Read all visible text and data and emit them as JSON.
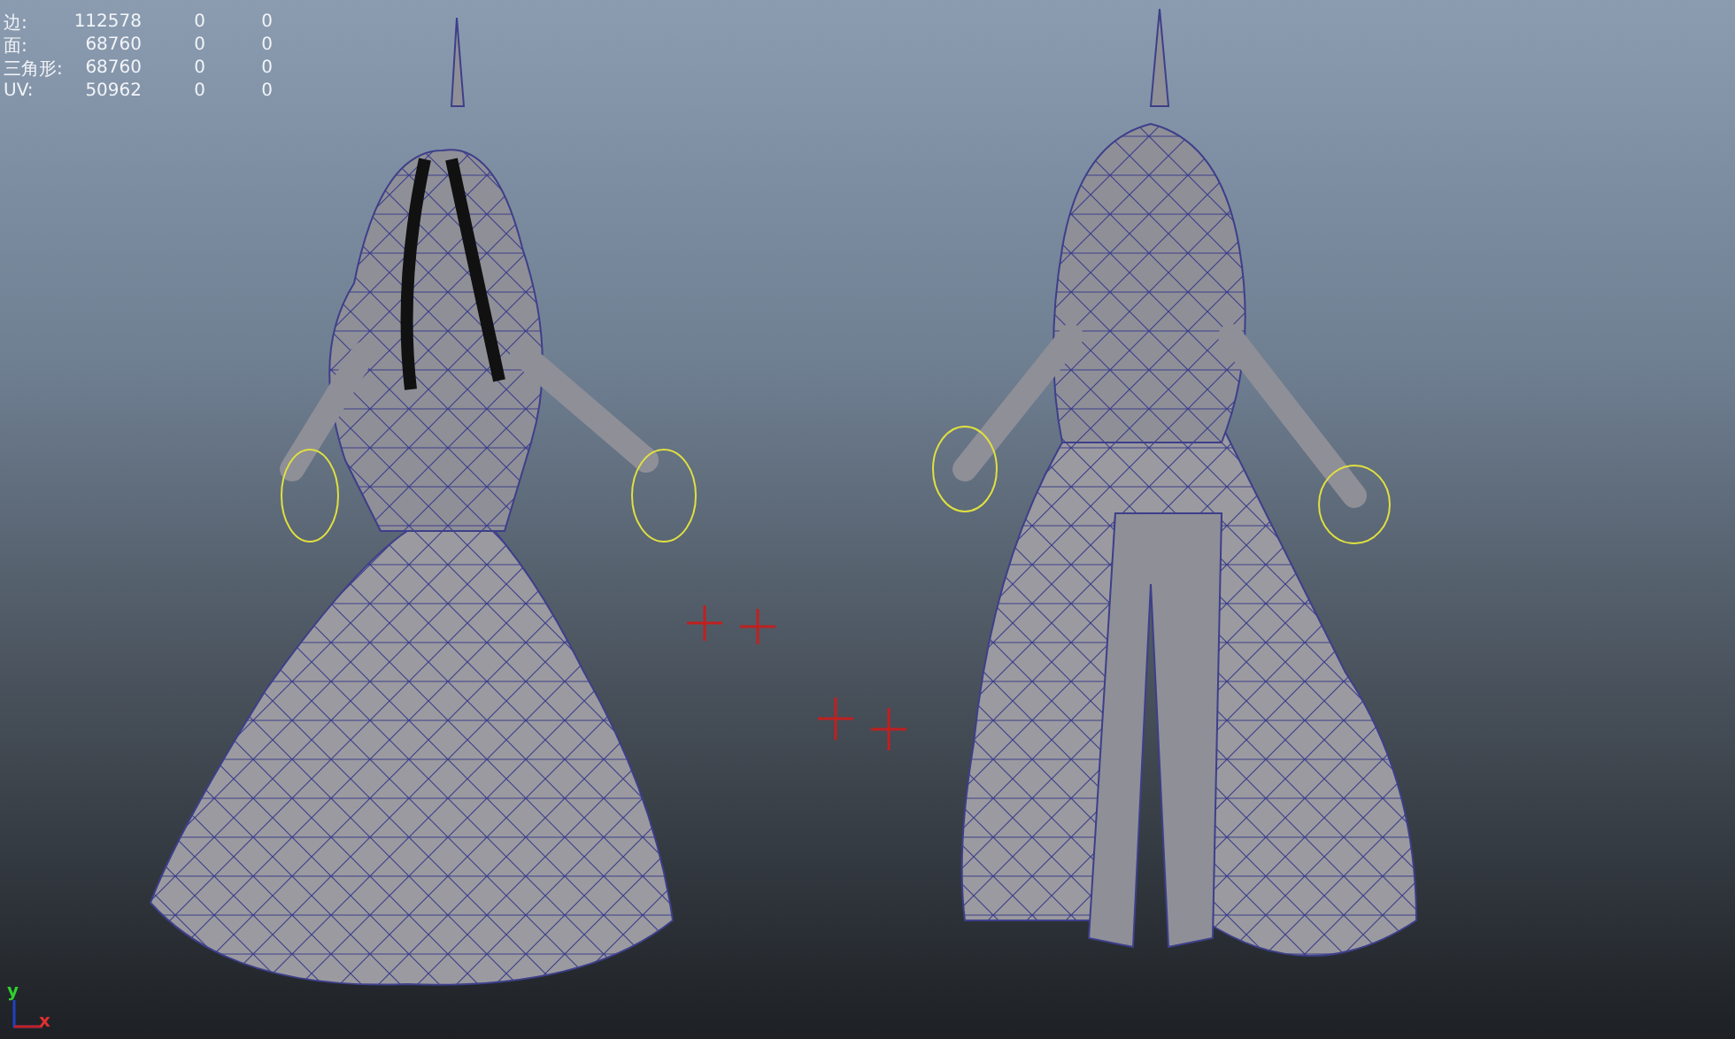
{
  "hud": {
    "rows": [
      {
        "label": "边:",
        "values": [
          "112578",
          "0",
          "0"
        ]
      },
      {
        "label": "面:",
        "values": [
          "68760",
          "0",
          "0"
        ]
      },
      {
        "label": "三角形:",
        "values": [
          "68760",
          "0",
          "0"
        ]
      },
      {
        "label": "UV:",
        "values": [
          "50962",
          "0",
          "0"
        ]
      }
    ]
  },
  "axis": {
    "y_label": "y",
    "x_label": "x"
  }
}
